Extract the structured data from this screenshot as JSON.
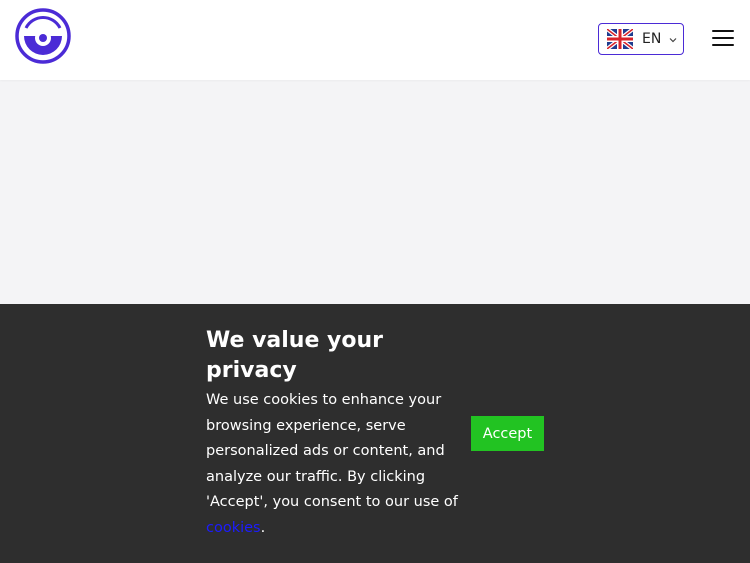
{
  "header": {
    "logo_icon": "logo-icon",
    "language": {
      "code": "EN",
      "flag_icon": "uk-flag-icon",
      "chevron_icon": "chevron-down-icon"
    },
    "menu_icon": "hamburger-menu-icon"
  },
  "cookie_banner": {
    "title": "We value your privacy",
    "text_before_link": "We use cookies to enhance your browsing experience, serve personalized ads or content, and analyze our traffic. By clicking 'Accept', you consent to our use of ",
    "link_text": "cookies",
    "text_after_link": ".",
    "accept_label": "Accept"
  },
  "colors": {
    "brand": "#4b2bd6",
    "overlay": "#2e2e2e",
    "accept": "#22c322",
    "link": "#1c1cff"
  }
}
